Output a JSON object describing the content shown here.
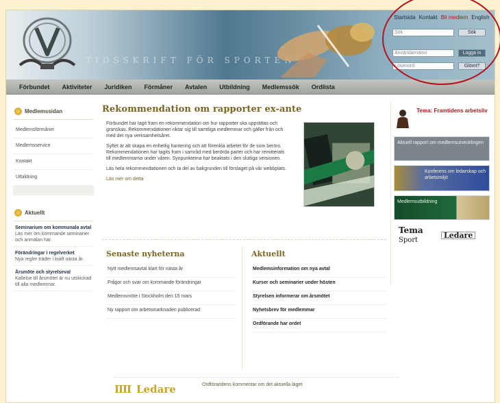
{
  "header": {
    "banner_text": "TIDSSKRIFT FÖR SPORTEN",
    "top_links": [
      "Startsida",
      "Kontakt",
      "Bli medlem",
      "English"
    ],
    "search_placeholder": "Sök",
    "search_button": "Sök",
    "login_user_placeholder": "Användarnamn",
    "login_button": "Logga in",
    "login_pass_placeholder": "Lösenord",
    "forgot_button": "Glömt?"
  },
  "nav": [
    "Förbundet",
    "Aktiviteter",
    "Juridiken",
    "Förmåner",
    "Avtalen",
    "Utbildning",
    "Medlemssök",
    "Ordlista"
  ],
  "sidebar": {
    "section1_title": "Medlemssidan",
    "links": [
      "Medlemsförmåner",
      "Medlemsservice",
      "Kontakt",
      "Utbildning"
    ],
    "section2_title": "Aktuellt",
    "news": [
      {
        "title": "Seminarium om kommunala avtal",
        "text": "Läs mer om kommande seminarier och anmälan här."
      },
      {
        "title": "Förändringar i regelverket",
        "text": "Nya regler träder i kraft nästa år."
      },
      {
        "title": "Årsmöte och styrelseval",
        "text": "Kallelse till årsmötet är nu utskickad till alla medlemmar."
      }
    ]
  },
  "main": {
    "title": "Rekommendation om rapporter ex-ante",
    "paragraphs": [
      "Förbundet har tagit fram en rekommendation om hur rapporter ska upprättas och granskas. Rekommendationen riktar sig till samtliga medlemmar och gäller från och med det nya verksamhetsåret.",
      "Syftet är att skapa en enhetlig hantering och att förenkla arbetet för de som berörs. Rekommendationen har tagits fram i samråd med berörda parter och har remitterats till medlemmarna under våren. Synpunkterna har beaktats i den slutliga versionen.",
      "Läs hela rekommendationen och ta del av bakgrunden till förslaget på vår webbplats."
    ],
    "more_link": "Läs mer om detta"
  },
  "columns": {
    "left_title": "Senaste nyheterna",
    "left_items": [
      "Nytt medlemsavtal klart för nästa år",
      "Frågor och svar om kommande förändringar",
      "Medlemsmöte i Stockholm den 15 mars",
      "Ny rapport om arbetsmarknaden publicerad"
    ],
    "right_title": "Aktuellt",
    "right_items": [
      "Medlemsinformation om nya avtal",
      "Kurser och seminarier under hösten",
      "Styrelsen informerar om årsmötet",
      "Nyhetsbrev för medlemmar",
      "Ordförande har ordet"
    ]
  },
  "bottom_banner": {
    "logo_a": "IIII",
    "logo_b": "Ledare",
    "text": "Ordförandens kommentar om det aktuella läget"
  },
  "right": {
    "theme_text": "Tema: Framtidens arbetsliv",
    "ad1": "Aktuell rapport om medlemsutvecklingen",
    "ad2": "Konferens om ledarskap och arbetsmiljö",
    "ad3": "Medlemsutbildning",
    "ad4_a": "Tema",
    "ad4_b": "Sport",
    "ad4_c": "Ledare"
  },
  "colors": {
    "accent_red": "#a41b1b",
    "heading_gold": "#7a6424",
    "page_bg": "#fdf1cf"
  }
}
